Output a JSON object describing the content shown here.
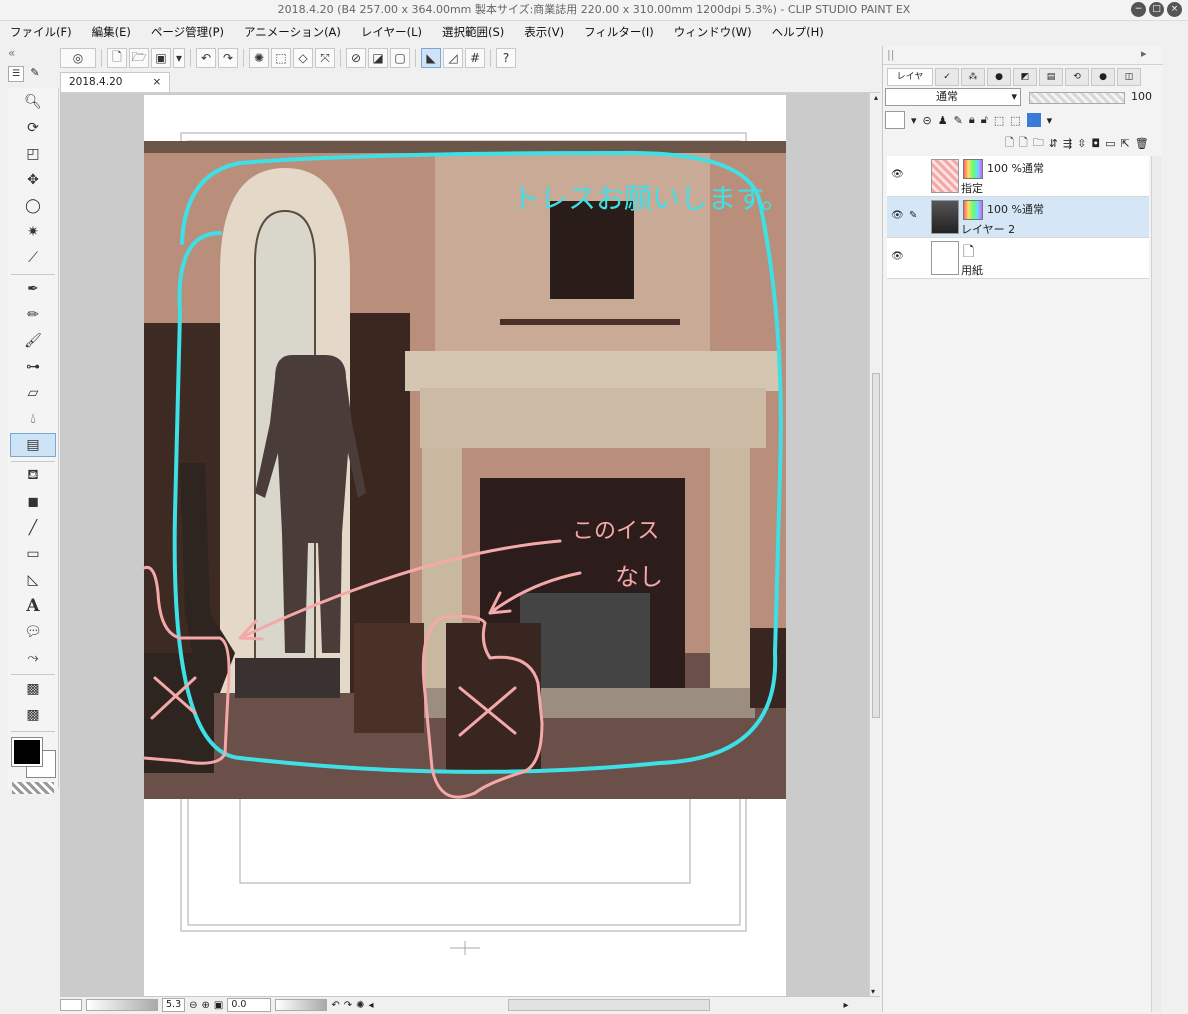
{
  "window": {
    "title": "2018.4.20 (B4 257.00 x 364.00mm 製本サイズ:商業誌用 220.00 x 310.00mm 1200dpi 5.3%) - CLIP STUDIO PAINT EX"
  },
  "menu": [
    "ファイル(F)",
    "編集(E)",
    "ページ管理(P)",
    "アニメーション(A)",
    "レイヤー(L)",
    "選択範囲(S)",
    "表示(V)",
    "フィルター(I)",
    "ウィンドウ(W)",
    "ヘルプ(H)"
  ],
  "tab": {
    "name": "2018.4.20",
    "close": "×"
  },
  "annotations": {
    "trace_request": "トレスお願いします。",
    "no_chair_line1": "このイス",
    "no_chair_line2": "なし"
  },
  "layers_panel": {
    "tab_label": "レイヤ",
    "blend_mode": "通常",
    "opacity": "100",
    "layers": [
      {
        "mode": "100 %通常",
        "name": "指定"
      },
      {
        "mode": "100 %通常",
        "name": "レイヤー 2"
      },
      {
        "mode": "",
        "name": "用紙"
      }
    ]
  },
  "status": {
    "zoom": "5.3",
    "angle": "0.0"
  },
  "colors": {
    "cyan_stroke": "#3ee0e6",
    "pink_stroke": "#f4a9a8",
    "selection": "#d5e7f6"
  }
}
